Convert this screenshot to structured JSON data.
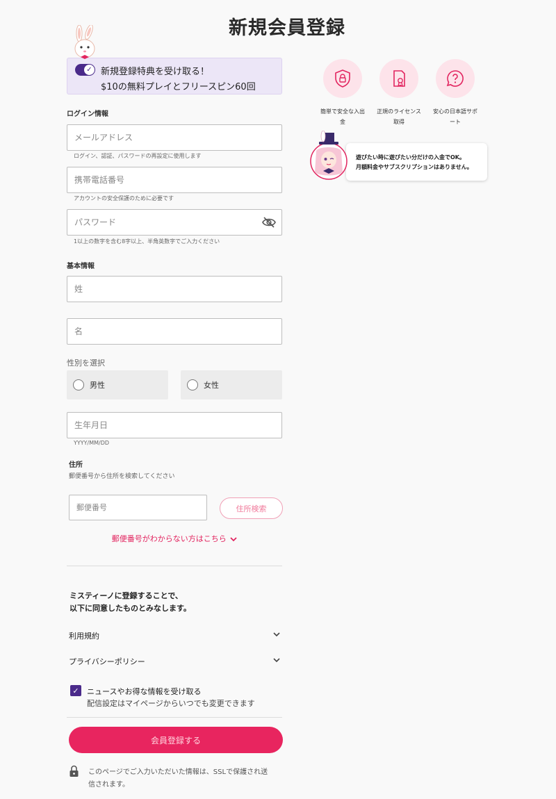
{
  "page": {
    "title": "新規会員登録"
  },
  "bonus": {
    "line1": "新規登録特典を受け取る！",
    "line2": "$10の無料プレイとフリースピン60回",
    "toggle_on": true
  },
  "login": {
    "section_label": "ログイン情報",
    "email": {
      "placeholder": "メールアドレス",
      "hint": "ログイン、認証、パスワードの再設定に使用します"
    },
    "phone": {
      "placeholder": "携帯電話番号",
      "hint": "アカウントの安全保護のために必要です"
    },
    "password": {
      "placeholder": "パスワード",
      "hint": "1以上の数字を含む8字以上、半角英数字でご入力ください"
    }
  },
  "basic": {
    "section_label": "基本情報",
    "last_name": {
      "placeholder": "姓"
    },
    "first_name": {
      "placeholder": "名"
    },
    "gender": {
      "label": "性別を選択",
      "male": "男性",
      "female": "女性"
    },
    "birthdate": {
      "placeholder": "生年月日",
      "hint": "YYYY/MM/DD"
    }
  },
  "address": {
    "label": "住所",
    "hint": "郵便番号から住所を検索してください",
    "postal": {
      "placeholder": "郵便番号"
    },
    "search_button": "住所検索",
    "help_link": "郵便番号がわからない方はこちら"
  },
  "agreement": {
    "line1": "ミスティーノに登録することで、",
    "line2": "以下に同意したものとみなします。",
    "terms": "利用規約",
    "privacy": "プライバシーポリシー"
  },
  "newsletter": {
    "checked": true,
    "line1": "ニュースやお得な情報を受け取る",
    "line2": "配信設定はマイページからいつでも変更できます"
  },
  "submit_label": "会員登録する",
  "ssl": {
    "line1": "このページでご入力いただいた情報は、SSLで保護され送",
    "line2": "信されます。"
  },
  "features": [
    {
      "icon": "shield-lock-icon",
      "label_line1": "簡単で安全な入出",
      "label_line2": "金"
    },
    {
      "icon": "license-certificate-icon",
      "label_line1": "正規のライセンス",
      "label_line2": "取得"
    },
    {
      "icon": "question-bubble-icon",
      "label_line1": "安心の日本語サポ",
      "label_line2": "ート"
    }
  ],
  "bubble": {
    "line1": "遊びたい時に遊びたい分だけの入金でOK。",
    "line2": "月額料金やサブスクリプションはありません。"
  },
  "colors": {
    "accent": "#e8255f",
    "purple": "#4a2a8a",
    "bonus_bg": "#ece6f7",
    "feature_bg": "#fde3ea"
  }
}
